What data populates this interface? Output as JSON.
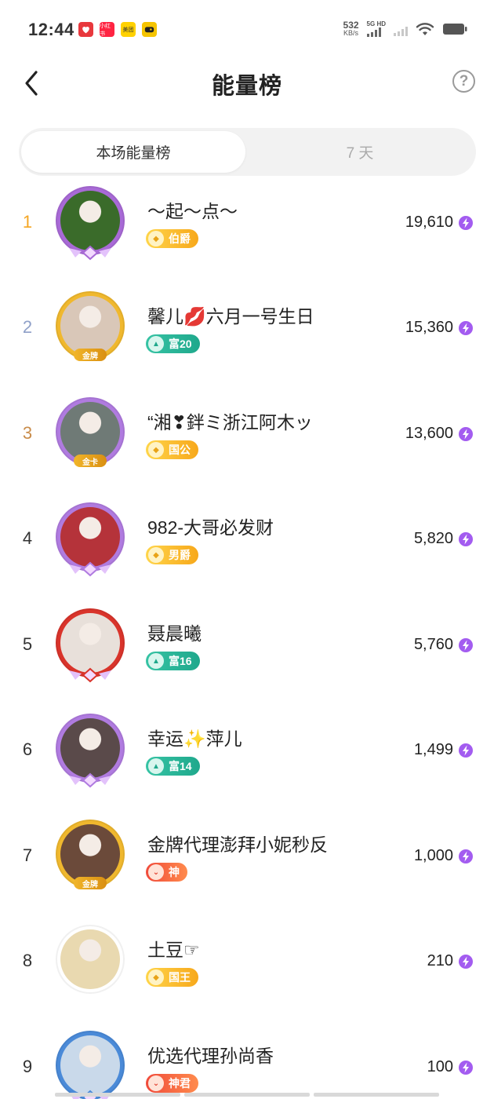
{
  "status_bar": {
    "time": "12:44",
    "apps": [
      {
        "icon": "heart-app-icon",
        "color": "#e8383d",
        "label": ""
      },
      {
        "icon": "xiaohongshu-app-icon",
        "color": "#ff2442",
        "label": "小红书"
      },
      {
        "icon": "meituan-app-icon",
        "color": "#ffd100",
        "label": "美团"
      },
      {
        "icon": "game-app-icon",
        "color": "#f5c400",
        "label": ""
      }
    ],
    "net_speed_value": "532",
    "net_speed_unit": "KB/s",
    "signal_label": "5G HD",
    "wifi": "wifi-icon",
    "battery": "battery-icon"
  },
  "header": {
    "title": "能量榜",
    "back_icon": "chevron-left-icon",
    "help_label": "?"
  },
  "tabs": [
    {
      "label": "本场能量榜",
      "active": true
    },
    {
      "label": "7 天",
      "active": false
    }
  ],
  "ranking": [
    {
      "rank": "1",
      "name": "～起～点～",
      "badge": "伯爵",
      "badge_type": "gold",
      "energy": "19,610",
      "avatar_color": "#3a6b2a",
      "ring": "#a86ad6",
      "frame_tag": ""
    },
    {
      "rank": "2",
      "name": "馨儿💋六月一号生日",
      "badge": "富20",
      "badge_type": "teal",
      "energy": "15,360",
      "avatar_color": "#d9c7b8",
      "ring": "#f0b82e",
      "frame_tag": "金牌"
    },
    {
      "rank": "3",
      "name": "“湘❣鉡ミ浙江阿木ッ",
      "badge": "国公",
      "badge_type": "gold",
      "energy": "13,600",
      "avatar_color": "#6f7a76",
      "ring": "#b07be0",
      "frame_tag": "金卡"
    },
    {
      "rank": "4",
      "name": "982-大哥必发财",
      "badge": "男爵",
      "badge_type": "gold",
      "energy": "5,820",
      "avatar_color": "#b5333a",
      "ring": "#b07be0",
      "frame_tag": ""
    },
    {
      "rank": "5",
      "name": "聂晨曦",
      "badge": "富16",
      "badge_type": "teal",
      "energy": "5,760",
      "avatar_color": "#e8e0da",
      "ring": "#d9342b",
      "frame_tag": ""
    },
    {
      "rank": "6",
      "name": "幸运✨萍儿",
      "badge": "富14",
      "badge_type": "teal",
      "energy": "1,499",
      "avatar_color": "#5a4a4a",
      "ring": "#b07be0",
      "frame_tag": ""
    },
    {
      "rank": "7",
      "name": "金牌代理澎拜小妮秒反",
      "badge": "神",
      "badge_type": "red",
      "energy": "1,000",
      "avatar_color": "#6b4a3a",
      "ring": "#f0b82e",
      "frame_tag": "金牌"
    },
    {
      "rank": "8",
      "name": "土豆☞",
      "badge": "国王",
      "badge_type": "gold",
      "energy": "210",
      "avatar_color": "#e9d9b0",
      "ring": "#ffffff",
      "frame_tag": ""
    },
    {
      "rank": "9",
      "name": "优选代理孙尚香",
      "badge": "神君",
      "badge_type": "red",
      "energy": "100",
      "avatar_color": "#c9d9ea",
      "ring": "#4a8ad8",
      "frame_tag": ""
    }
  ],
  "colors": {
    "rank1": "#f5a623",
    "rank2": "#8fa0c8",
    "rank3": "#c98c4a",
    "energy_icon": "#a35cf0"
  }
}
